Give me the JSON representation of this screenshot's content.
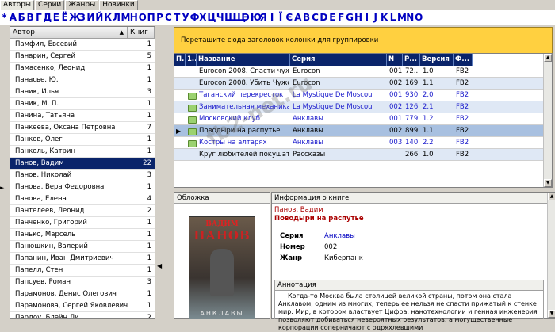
{
  "tabs": [
    "Авторы",
    "Серии",
    "Жанры",
    "Новинки"
  ],
  "alphabet": [
    "*",
    "А",
    "Б",
    "В",
    "Г",
    "Д",
    "Е",
    "Ё",
    "Ж",
    "З",
    "И",
    "Й",
    "К",
    "Л",
    "М",
    "Н",
    "О",
    "П",
    "Р",
    "С",
    "Т",
    "У",
    "Ф",
    "Х",
    "Ц",
    "Ч",
    "Ш",
    "Щ",
    "Э",
    "Ю",
    "Я",
    "І",
    "Ї",
    "Є",
    "A",
    "B",
    "C",
    "D",
    "E",
    "F",
    "G",
    "H",
    "I",
    "J",
    "K",
    "L",
    "M",
    "N",
    "O"
  ],
  "authors": {
    "col_author": "Автор",
    "col_books": "Книг",
    "rows": [
      {
        "name": "Памфил, Евсевий",
        "count": "1"
      },
      {
        "name": "Панарин, Сергей",
        "count": "5"
      },
      {
        "name": "Памасенко, Леонид",
        "count": "1"
      },
      {
        "name": "Панасье, Ю.",
        "count": "1"
      },
      {
        "name": "Паник, Илья",
        "count": "3"
      },
      {
        "name": "Паник, М. П.",
        "count": "1"
      },
      {
        "name": "Панина, Татьяна",
        "count": "1"
      },
      {
        "name": "Панкеева, Оксана Петровна",
        "count": "7"
      },
      {
        "name": "Панков, Олег",
        "count": "1"
      },
      {
        "name": "Панколь, Катрин",
        "count": "1"
      },
      {
        "name": "Панов, Вадим",
        "count": "22"
      },
      {
        "name": "Панов, Николай",
        "count": "3"
      },
      {
        "name": "Панова, Вера Федоровна",
        "count": "1"
      },
      {
        "name": "Панова, Елена",
        "count": "4"
      },
      {
        "name": "Пантелеев, Леонид",
        "count": "2"
      },
      {
        "name": "Панченко, Григорий",
        "count": "1"
      },
      {
        "name": "Панько, Марсель",
        "count": "1"
      },
      {
        "name": "Панюшкин, Валерий",
        "count": "1"
      },
      {
        "name": "Папанин, Иван Дмитриевич",
        "count": "1"
      },
      {
        "name": "Папелл, Стен",
        "count": "1"
      },
      {
        "name": "Папсуев, Роман",
        "count": "3"
      },
      {
        "name": "Парамонов, Денис Олегович",
        "count": "1"
      },
      {
        "name": "Парамонова, Сергей Яковлевич",
        "count": "1"
      },
      {
        "name": "Пардоу, Блейн Ли",
        "count": "2"
      }
    ],
    "selected_index": 10
  },
  "group_hint": "Перетащите сюда заголовок колонки для группировки",
  "books": {
    "columns": [
      "П...",
      "1...",
      "Название",
      "Серия",
      "N",
      "Р...",
      "Версия",
      "Ф..."
    ],
    "rows": [
      {
        "title": "Eurocon 2008. Спасти чужого",
        "series": "Eurocon",
        "num": "001",
        "size": "72...",
        "ver": "1.0",
        "fmt": "FB2",
        "icon": false,
        "link": false
      },
      {
        "title": "Eurocon 2008. Убить Чужого",
        "series": "Eurocon",
        "num": "002",
        "size": "169...",
        "ver": "1.1",
        "fmt": "FB2",
        "icon": false,
        "link": false
      },
      {
        "title": "Таганский перекресток",
        "series": "La Mystique De Moscou",
        "num": "001",
        "size": "930...",
        "ver": "2.0",
        "fmt": "FB2",
        "icon": true,
        "link": true
      },
      {
        "title": "Занимательная механика",
        "series": "La Mystique De Moscou",
        "num": "002",
        "size": "126...",
        "ver": "2.1",
        "fmt": "FB2",
        "icon": true,
        "link": true
      },
      {
        "title": "Московский клуб",
        "series": "Анклавы",
        "num": "001",
        "size": "779...",
        "ver": "1.2",
        "fmt": "FB2",
        "icon": true,
        "link": true
      },
      {
        "title": "Поводыри на распутье",
        "series": "Анклавы",
        "num": "002",
        "size": "899...",
        "ver": "1.1",
        "fmt": "FB2",
        "icon": true,
        "link": false
      },
      {
        "title": "Костры на алтарях",
        "series": "Анклавы",
        "num": "003",
        "size": "140...",
        "ver": "2.2",
        "fmt": "FB2",
        "icon": true,
        "link": true
      },
      {
        "title": "Круг любителей покушать",
        "series": "Рассказы",
        "num": "",
        "size": "266...",
        "ver": "1.0",
        "fmt": "FB2",
        "icon": false,
        "link": false
      }
    ],
    "selected_index": 5
  },
  "cover": {
    "label": "Обложка",
    "author_line1": "ВАДИМ",
    "author_line2": "ПАНОВ",
    "book_title": "АНКЛАВЫ"
  },
  "info": {
    "label": "Информация о книге",
    "author": "Панов, Вадим",
    "title": "Поводыри на распутье",
    "series_label": "Серия",
    "series_value": "Анклавы",
    "number_label": "Номер",
    "number_value": "002",
    "genre_label": "Жанр",
    "genre_value": "Киберпанк",
    "annotation_label": "Аннотация",
    "annotation_text": "Когда-то Москва была столицей великой страны, потом она стала Анклавом, одним из многих, теперь ее нельзя не спасти прижатый к стенке мир. Мир, в котором властвует Цифра, нанотехнологии и генная инженерия позволяют добиваться невероятных результатов, а могущественные корпорации соперничают с одряхлевшими"
  },
  "watermark": "fb2-net.ru"
}
